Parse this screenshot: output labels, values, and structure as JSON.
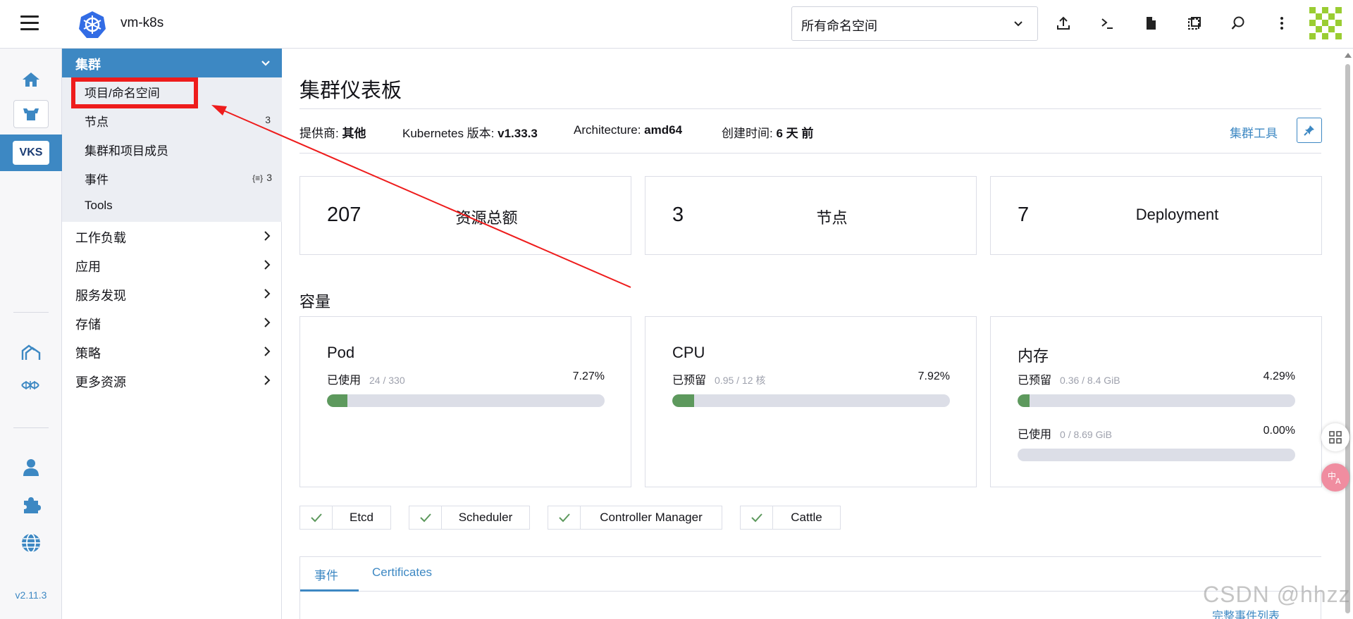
{
  "header": {
    "cluster_name": "vm-k8s",
    "namespace_value": "所有命名空间"
  },
  "rail": {
    "vks_label": "VKS",
    "version": "v2.11.3"
  },
  "nav": {
    "group_title": "集群",
    "sub_items": [
      {
        "label": "项目/命名空间",
        "count": ""
      },
      {
        "label": "节点",
        "count": "3"
      },
      {
        "label": "集群和项目成员",
        "count": ""
      },
      {
        "label": "事件",
        "count": "3"
      },
      {
        "label": "Tools",
        "count": ""
      }
    ],
    "items": [
      "工作负载",
      "应用",
      "服务发现",
      "存储",
      "策略",
      "更多资源"
    ]
  },
  "main": {
    "title": "集群仪表板",
    "meta": {
      "provider_label": "提供商:",
      "provider_value": "其他",
      "k8s_label": "Kubernetes 版本:",
      "k8s_value": "v1.33.3",
      "arch_label": "Architecture:",
      "arch_value": "amd64",
      "created_label": "创建时间:",
      "created_value": "6 天 前"
    },
    "tools_link": "集群工具",
    "stats": [
      {
        "num": "207",
        "label": "资源总额"
      },
      {
        "num": "3",
        "label": "节点"
      },
      {
        "num": "7",
        "label": "Deployment"
      }
    ],
    "capacity_title": "容量",
    "capacity": [
      {
        "title": "Pod",
        "rows": [
          {
            "label": "已使用",
            "sub": "24 / 330",
            "pct": "7.27%",
            "fill": 0.0727
          }
        ]
      },
      {
        "title": "CPU",
        "rows": [
          {
            "label": "已预留",
            "sub": "0.95 / 12 核",
            "pct": "7.92%",
            "fill": 0.0792
          }
        ]
      },
      {
        "title": "内存",
        "rows": [
          {
            "label": "已预留",
            "sub": "0.36 / 8.4 GiB",
            "pct": "4.29%",
            "fill": 0.0429
          },
          {
            "label": "已使用",
            "sub": "0 / 8.69 GiB",
            "pct": "0.00%",
            "fill": 0
          }
        ]
      }
    ],
    "components": [
      "Etcd",
      "Scheduler",
      "Controller Manager",
      "Cattle"
    ],
    "tabs": [
      "事件",
      "Certificates"
    ],
    "full_events_link": "完整事件列表"
  },
  "watermark": "CSDN @hhzz",
  "colors": {
    "accent": "#3d88c3",
    "success": "#5d995d",
    "annotation": "#ee1c1c"
  }
}
